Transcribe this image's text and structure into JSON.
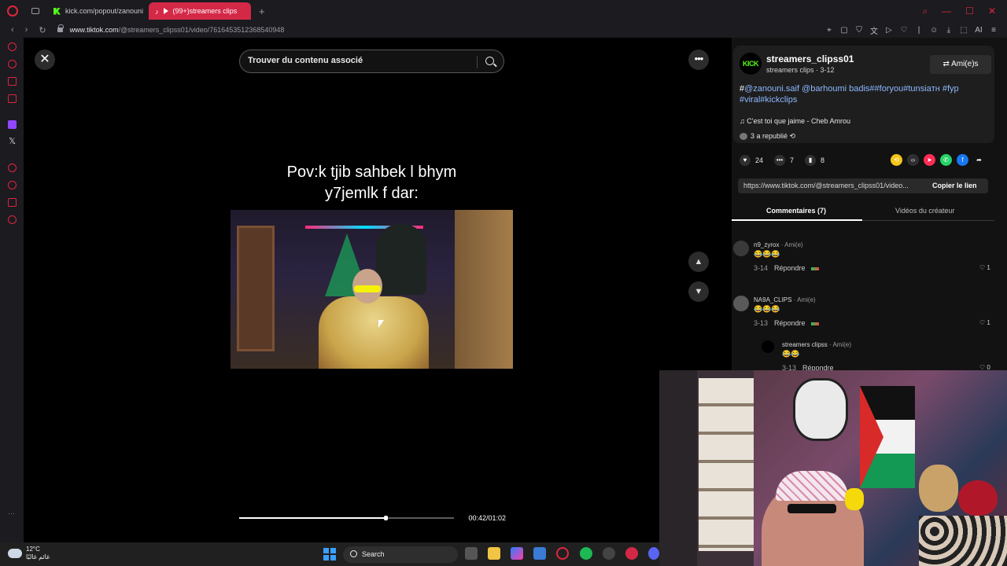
{
  "browser": {
    "tabs": [
      {
        "label": "kick.com/popout/zanouni"
      },
      {
        "label": "(99+)streamers clips"
      }
    ],
    "url_host": "www.tiktok.com",
    "url_path": "/@streamers_clipss01/video/7616453512368540948"
  },
  "viewer": {
    "search_placeholder": "Trouver du contenu associé",
    "video_title_line1": "Pov:k tjib sahbek l bhym",
    "video_title_line2": "y7jemlk f dar:",
    "progress_fraction": 0.68,
    "timecode": "00:42/01:02"
  },
  "post": {
    "avatar_text": "KICK",
    "username": "streamers_clipss01",
    "subtitle": "streamers clips · 3-12",
    "friends_label": "Ami(e)s",
    "description_prefix": "#",
    "description_tags": "@zanouni.saif @barhoumi badis##foryou#tunsiaтн #fyp #viral#kickclips",
    "music": "C'est toi que jaime - Cheb Amrou",
    "reposted": "3 a republié",
    "likes": "24",
    "comments": "7",
    "saves": "8",
    "link": "https://www.tiktok.com/@streamers_clipss01/video...",
    "copy_label": "Copier le lien"
  },
  "tabs": {
    "comments_label": "Commentaires (7)",
    "creator_videos_label": "Vidéos du créateur"
  },
  "comments": [
    {
      "name": "n9_zyrox",
      "relation": " · Ami(e)",
      "text": "😂😂😂",
      "date": "3-14",
      "reply_label": "Répondre",
      "likes": "1"
    },
    {
      "name": "NA9A_CLIPS",
      "relation": " · Ami(e)",
      "text": "😂😂😂",
      "date": "3-13",
      "reply_label": "Répondre",
      "likes": "1"
    },
    {
      "name": "streamers clipss",
      "relation": " · Ami(e)",
      "text": "😂😂",
      "date": "3-13",
      "reply_label": "Répondre",
      "likes": "0"
    }
  ],
  "taskbar": {
    "temperature": "12°C",
    "weather_caption": "غائم غالبًا",
    "search_label": "Search"
  },
  "colors": {
    "opera_red": "#e0263c",
    "kick_green": "#53fc18",
    "link_blue": "#8bb8ff"
  }
}
